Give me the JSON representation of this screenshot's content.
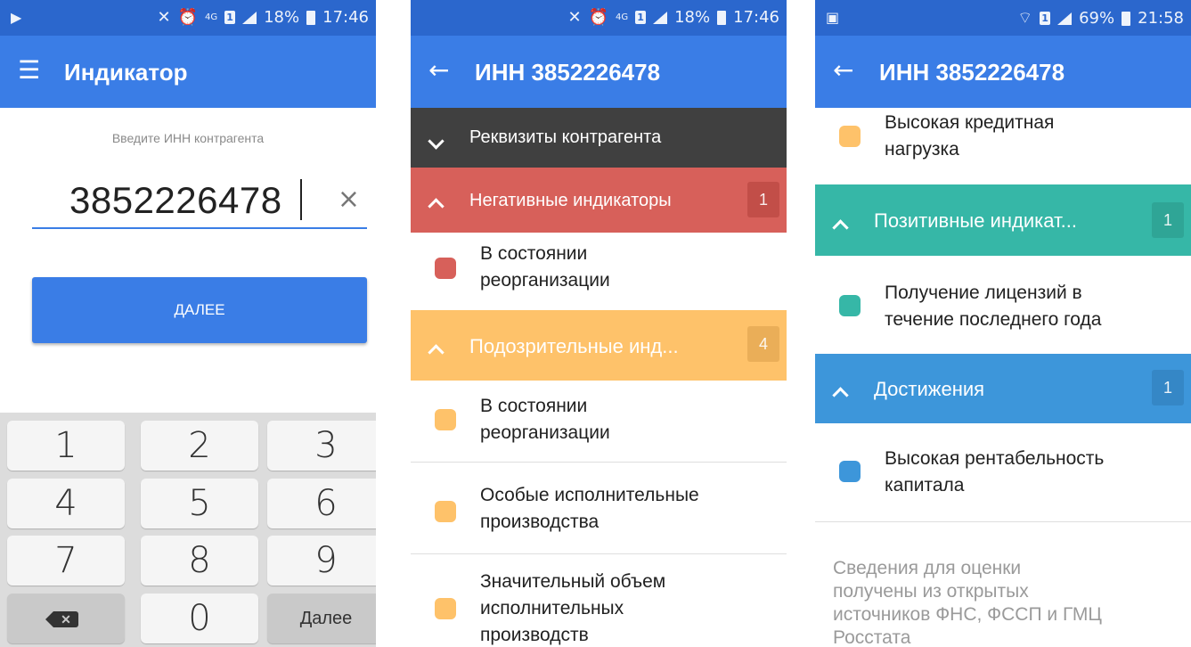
{
  "colors": {
    "status_bar": "#2b67cd",
    "app_bar": "#3a7de6",
    "details_header": "#404040",
    "negative": "#d7605a",
    "suspicious": "#fec26a",
    "positive": "#36b7a7",
    "achievements": "#3d96da"
  },
  "screen1": {
    "status": {
      "left_icon": "play-icon",
      "badge_4g": "4G",
      "battery": "18%",
      "time": "17:46"
    },
    "app_title": "Индикатор",
    "hint": "Введите ИНН контрагента",
    "inn_value": "3852226478",
    "next_button": "ДАЛЕЕ",
    "keys": [
      "1",
      "2",
      "3",
      "4",
      "5",
      "6",
      "7",
      "8",
      "9",
      "0"
    ],
    "key_next": "Далее"
  },
  "screen2": {
    "status": {
      "badge_4g": "4G",
      "battery": "18%",
      "time": "17:46"
    },
    "title": "ИНН 3852226478",
    "details_header": "Реквизиты контрагента",
    "negative": {
      "label": "Негативные индикаторы",
      "count": "1",
      "items": [
        "В состоянии\nреорганизации"
      ]
    },
    "suspicious": {
      "label": "Подозрительные инд...",
      "count": "4",
      "items": [
        "В состоянии\nреорганизации",
        "Особые исполнительные\nпроизводства",
        "Значительный объем\nисполнительных\nпроизводств"
      ]
    }
  },
  "screen3": {
    "status": {
      "battery": "69%",
      "time": "21:58"
    },
    "title": "ИНН 3852226478",
    "top_item": "Высокая кредитная\nнагрузка",
    "positive": {
      "label": "Позитивные индикат...",
      "count": "1",
      "items": [
        "Получение лицензий в\nтечение последнего года"
      ]
    },
    "achievements": {
      "label": "Достижения",
      "count": "1",
      "items": [
        "Высокая рентабельность\nкапитала"
      ]
    },
    "footnote": "Сведения для оценки\nполучены из открытых\nисточников ФНС, ФССП и ГМЦ\nРосстата"
  }
}
